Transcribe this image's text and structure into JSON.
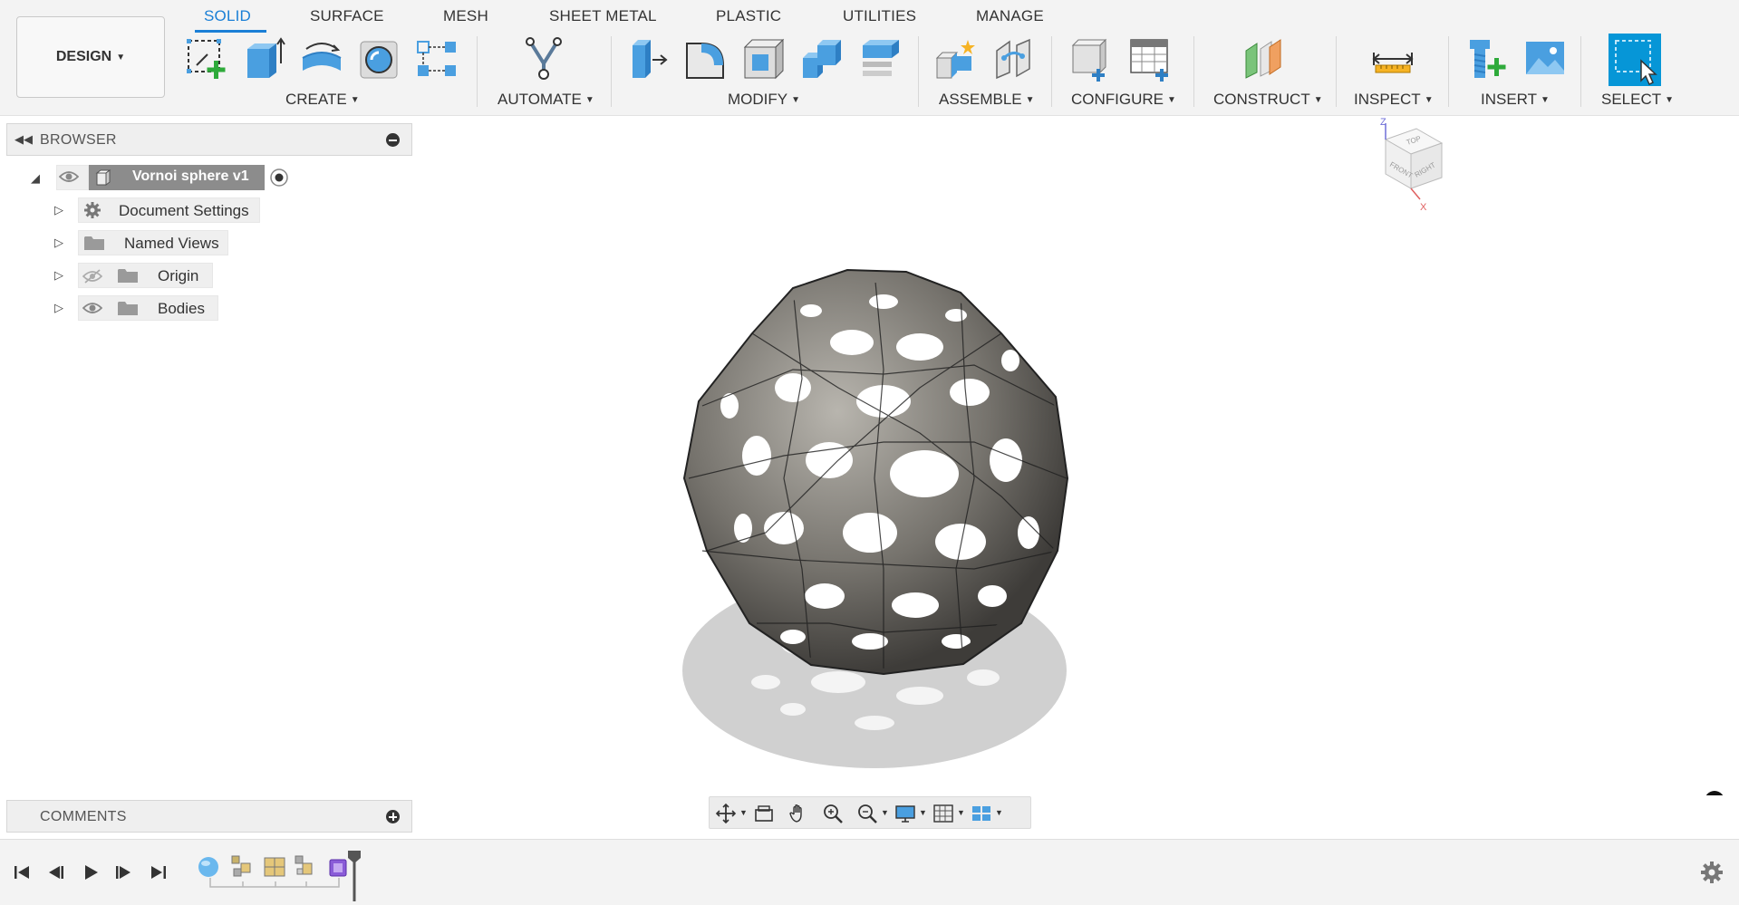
{
  "tabs": [
    {
      "label": "SOLID",
      "active": true
    },
    {
      "label": "SURFACE"
    },
    {
      "label": "MESH"
    },
    {
      "label": "SHEET METAL"
    },
    {
      "label": "PLASTIC"
    },
    {
      "label": "UTILITIES"
    },
    {
      "label": "MANAGE"
    }
  ],
  "workspace": {
    "label": "DESIGN"
  },
  "groups": {
    "create": "CREATE",
    "automate": "AUTOMATE",
    "modify": "MODIFY",
    "assemble": "ASSEMBLE",
    "configure": "CONFIGURE",
    "construct": "CONSTRUCT",
    "inspect": "INSPECT",
    "insert": "INSERT",
    "select": "SELECT"
  },
  "browser": {
    "title": "BROWSER",
    "root": "Vornoi sphere v1",
    "items": [
      {
        "label": "Document Settings",
        "icon": "gear-icon"
      },
      {
        "label": "Named Views",
        "icon": "folder-icon"
      },
      {
        "label": "Origin",
        "icon": "folder-icon",
        "visible": false
      },
      {
        "label": "Bodies",
        "icon": "folder-icon",
        "visible": true
      }
    ]
  },
  "comments": {
    "title": "COMMENTS"
  },
  "viewcube": {
    "top": "TOP",
    "front": "FRONT",
    "right": "RIGHT",
    "axis_z": "Z",
    "axis_x": "X"
  },
  "colors": {
    "accent": "#1a7fd6",
    "icon_blue": "#4a9fe0",
    "select_blue": "#0696d7"
  }
}
